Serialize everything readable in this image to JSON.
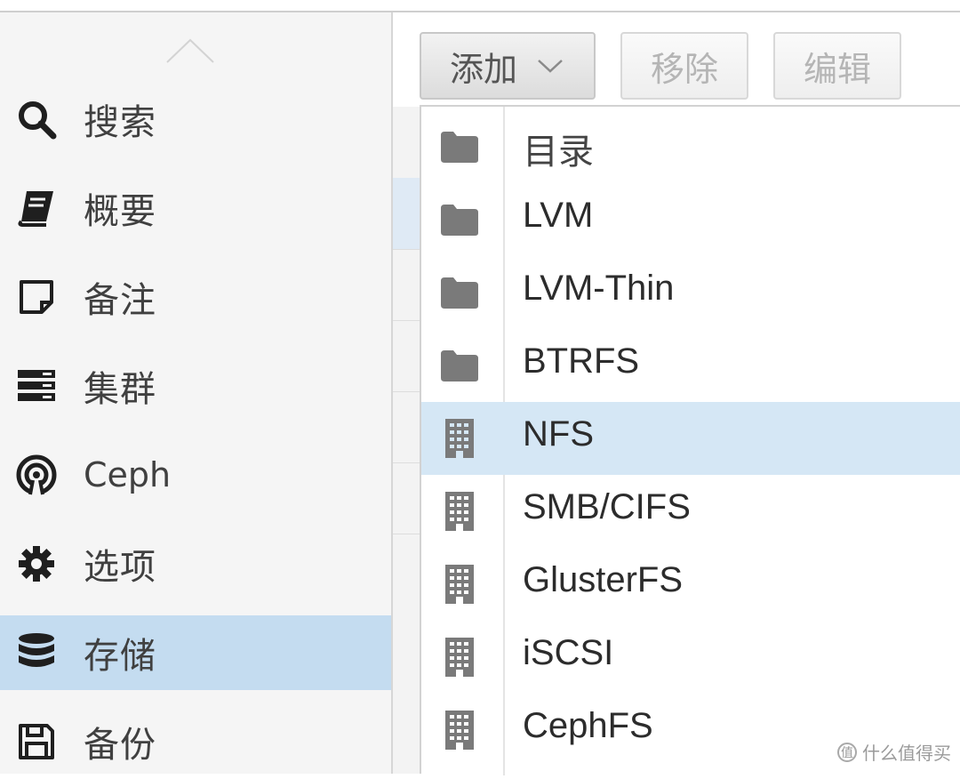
{
  "sidebar": {
    "items": [
      {
        "label": "搜索",
        "icon": "search-icon"
      },
      {
        "label": "概要",
        "icon": "book-icon"
      },
      {
        "label": "备注",
        "icon": "note-icon"
      },
      {
        "label": "集群",
        "icon": "server-icon"
      },
      {
        "label": "Ceph",
        "icon": "ceph-icon"
      },
      {
        "label": "选项",
        "icon": "gear-icon"
      },
      {
        "label": "存储",
        "icon": "database-icon",
        "active": true
      },
      {
        "label": "备份",
        "icon": "floppy-icon"
      }
    ]
  },
  "toolbar": {
    "add_label": "添加",
    "remove_label": "移除",
    "edit_label": "编辑"
  },
  "add_menu": {
    "items": [
      {
        "label": "目录",
        "icon": "folder-icon"
      },
      {
        "label": "LVM",
        "icon": "folder-icon"
      },
      {
        "label": "LVM-Thin",
        "icon": "folder-icon"
      },
      {
        "label": "BTRFS",
        "icon": "folder-icon"
      },
      {
        "label": "NFS",
        "icon": "building-icon",
        "highlighted": true
      },
      {
        "label": "SMB/CIFS",
        "icon": "building-icon"
      },
      {
        "label": "GlusterFS",
        "icon": "building-icon"
      },
      {
        "label": "iSCSI",
        "icon": "building-icon"
      },
      {
        "label": "CephFS",
        "icon": "building-icon"
      }
    ]
  },
  "watermark": {
    "text": "什么值得买",
    "badge": "值"
  },
  "colors": {
    "active_bg": "#c4dcf0",
    "highlight_bg": "#d5e7f5",
    "icon_gray": "#7a7a7a"
  }
}
